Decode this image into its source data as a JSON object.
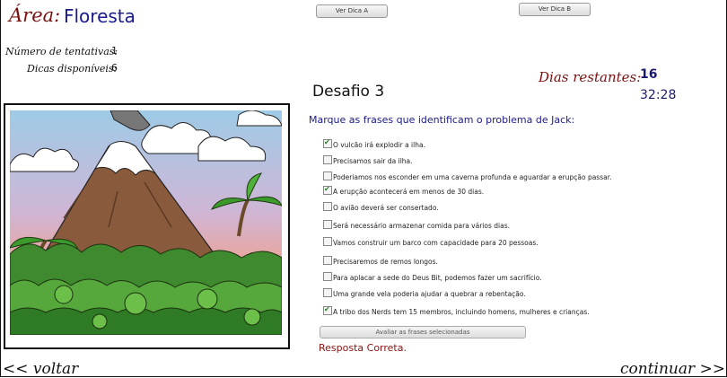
{
  "area": {
    "label": "Área:",
    "value": "Floresta"
  },
  "stats": {
    "attempts_label": "Número de tentativas:",
    "attempts_value": "1",
    "hints_label": "Dicas disponíveis:",
    "hints_value": "6"
  },
  "hint_buttons": {
    "a": "Ver Dica A",
    "b": "Ver Dica B"
  },
  "days": {
    "label": "Dias restantes:",
    "value": "16",
    "timer": "32:28"
  },
  "challenge": {
    "title": "Desafio 3",
    "prompt": "Marque as frases que identificam o problema de Jack:",
    "options": [
      {
        "text": "O vulcão irá explodir a ilha.",
        "checked": true
      },
      {
        "text": "Precisamos sair da ilha.",
        "checked": false
      },
      {
        "text": "Poderiamos nos esconder em uma caverna profunda e aguardar a erupção passar.",
        "checked": false
      },
      {
        "text": "A erupção acontecerá em menos de 30 dias.",
        "checked": true
      },
      {
        "text": "O avião deverá ser consertado.",
        "checked": false
      },
      {
        "text": "Será necessário armazenar comida para vários dias.",
        "checked": false
      },
      {
        "text": "Vamos construir um barco com capacidade para 20 pessoas.",
        "checked": false
      },
      {
        "text": "Precisaremos de remos longos.",
        "checked": false
      },
      {
        "text": "Para aplacar a sede do Deus Bit, podemos fazer um sacrifício.",
        "checked": false
      },
      {
        "text": "Uma grande vela poderia ajudar a quebrar a rebentação.",
        "checked": false
      },
      {
        "text": "A tribo dos Nerds tem 15 membros, incluindo homens, mulheres e crianças.",
        "checked": true
      }
    ],
    "evaluate_button": "Avaliar as frases selecionadas",
    "feedback": "Resposta Correta."
  },
  "nav": {
    "back": "<< voltar",
    "next": "continuar >>"
  }
}
